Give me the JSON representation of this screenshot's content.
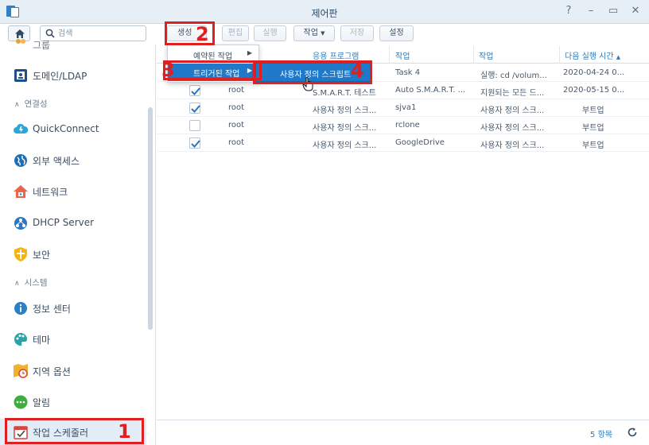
{
  "window": {
    "title": "제어판",
    "controls": [
      "?",
      "–",
      "▭",
      "✕"
    ]
  },
  "sidebar": {
    "search_placeholder": "검색",
    "items": [
      {
        "label": "그룹",
        "icon": "group-icon"
      },
      {
        "label": "도메인/LDAP",
        "icon": "domain-ldap-icon"
      },
      {
        "label": "QuickConnect",
        "icon": "quickconnect-icon"
      },
      {
        "label": "외부 액세스",
        "icon": "external-access-icon"
      },
      {
        "label": "네트워크",
        "icon": "network-icon"
      },
      {
        "label": "DHCP Server",
        "icon": "dhcp-server-icon"
      },
      {
        "label": "보안",
        "icon": "security-shield-icon"
      },
      {
        "label": "정보 센터",
        "icon": "info-center-icon"
      },
      {
        "label": "테마",
        "icon": "theme-palette-icon"
      },
      {
        "label": "지역 옵션",
        "icon": "regional-options-icon"
      },
      {
        "label": "알림",
        "icon": "notification-icon"
      },
      {
        "label": "작업 스케줄러",
        "icon": "task-scheduler-icon"
      }
    ],
    "sections": {
      "connectivity": "연결성",
      "system": "시스템"
    }
  },
  "toolbar": {
    "create": "생성",
    "edit": "편집",
    "run": "실행",
    "action": "작업",
    "save": "저장",
    "settings": "설정"
  },
  "create_menu": {
    "scheduled": "예약된 작업",
    "triggered": "트리거된 작업",
    "submenu_user_script": "사용자 정의 스크립트"
  },
  "table": {
    "headers": [
      "응용 프로그램",
      "작업",
      "작업",
      "다음 실행 시간"
    ],
    "sort_indicator": "▲",
    "rows": [
      {
        "checked": false,
        "user": "",
        "app": "",
        "task": "Task 4",
        "action": "실행: cd /volum...",
        "next": "2020-04-24 0..."
      },
      {
        "checked": true,
        "user": "root",
        "app": "S.M.A.R.T. 테스트",
        "task": "Auto S.M.A.R.T. ...",
        "action": "지원되는 모든 드...",
        "next": "2020-05-15 0..."
      },
      {
        "checked": true,
        "user": "root",
        "app": "사용자 정의 스크...",
        "task": "sjva1",
        "action": "사용자 정의 스크...",
        "next": "부트업"
      },
      {
        "checked": false,
        "user": "root",
        "app": "사용자 정의 스크...",
        "task": "rclone",
        "action": "사용자 정의 스크...",
        "next": "부트업"
      },
      {
        "checked": true,
        "user": "root",
        "app": "사용자 정의 스크...",
        "task": "GoogleDrive",
        "action": "사용자 정의 스크...",
        "next": "부트업"
      }
    ]
  },
  "footer": {
    "count": "5 항목"
  },
  "annotations": [
    "1",
    "2",
    "3",
    "4"
  ],
  "colors": {
    "accent": "#1f78c8",
    "annotation": "#e02020",
    "titlebar": "#e6eef6"
  }
}
